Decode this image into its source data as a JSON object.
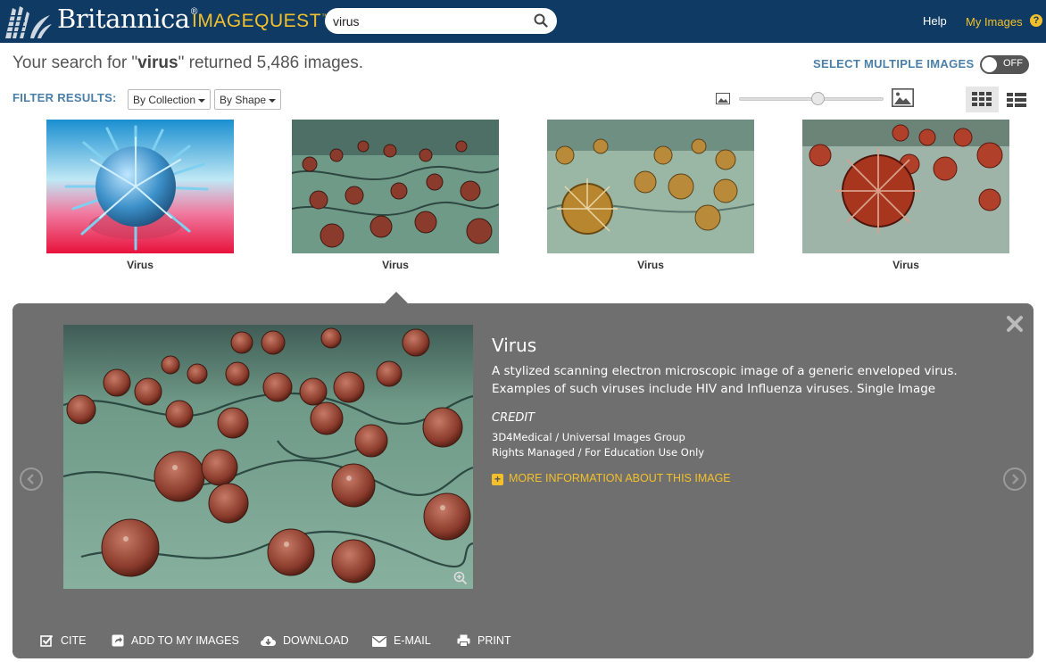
{
  "header": {
    "brand": "Britannica",
    "brand_mark": "®",
    "product": "IMAGEQUEST",
    "product_mark": "™",
    "search_value": "virus",
    "help_label": "Help",
    "my_images_label": "My Images",
    "help_badge": "?"
  },
  "results": {
    "prefix": "Your search for \"",
    "query": "virus",
    "suffix": "\" returned 5,486 images."
  },
  "select_multiple": {
    "label": "SELECT MULTIPLE IMAGES",
    "toggle_state": "OFF"
  },
  "filters": {
    "label": "FILTER RESULTS:",
    "by_collection": "By Collection",
    "by_shape": "By Shape"
  },
  "thumbnail_size": 0.55,
  "thumbnails": [
    {
      "title": "Virus"
    },
    {
      "title": "Virus"
    },
    {
      "title": "Virus"
    },
    {
      "title": "Virus"
    }
  ],
  "detail": {
    "title": "Virus",
    "description": "A stylized scanning electron microscopic image of a generic enveloped virus. Examples of such viruses include HIV and Influenza viruses. Single Image",
    "credit_heading": "CREDIT",
    "credit_source": "3D4Medical / Universal Images Group",
    "rights": "Rights Managed / For Education Use Only",
    "more_info": "MORE INFORMATION ABOUT THIS IMAGE",
    "actions": {
      "cite": "CITE",
      "add": "ADD TO MY IMAGES",
      "download": "DOWNLOAD",
      "email": "E-MAIL",
      "print": "PRINT"
    }
  },
  "colors": {
    "header_bg": "#0e3a63",
    "accent_gold": "#f3c02b",
    "label_blue": "#4a7fa8",
    "panel_bg": "#646464"
  }
}
